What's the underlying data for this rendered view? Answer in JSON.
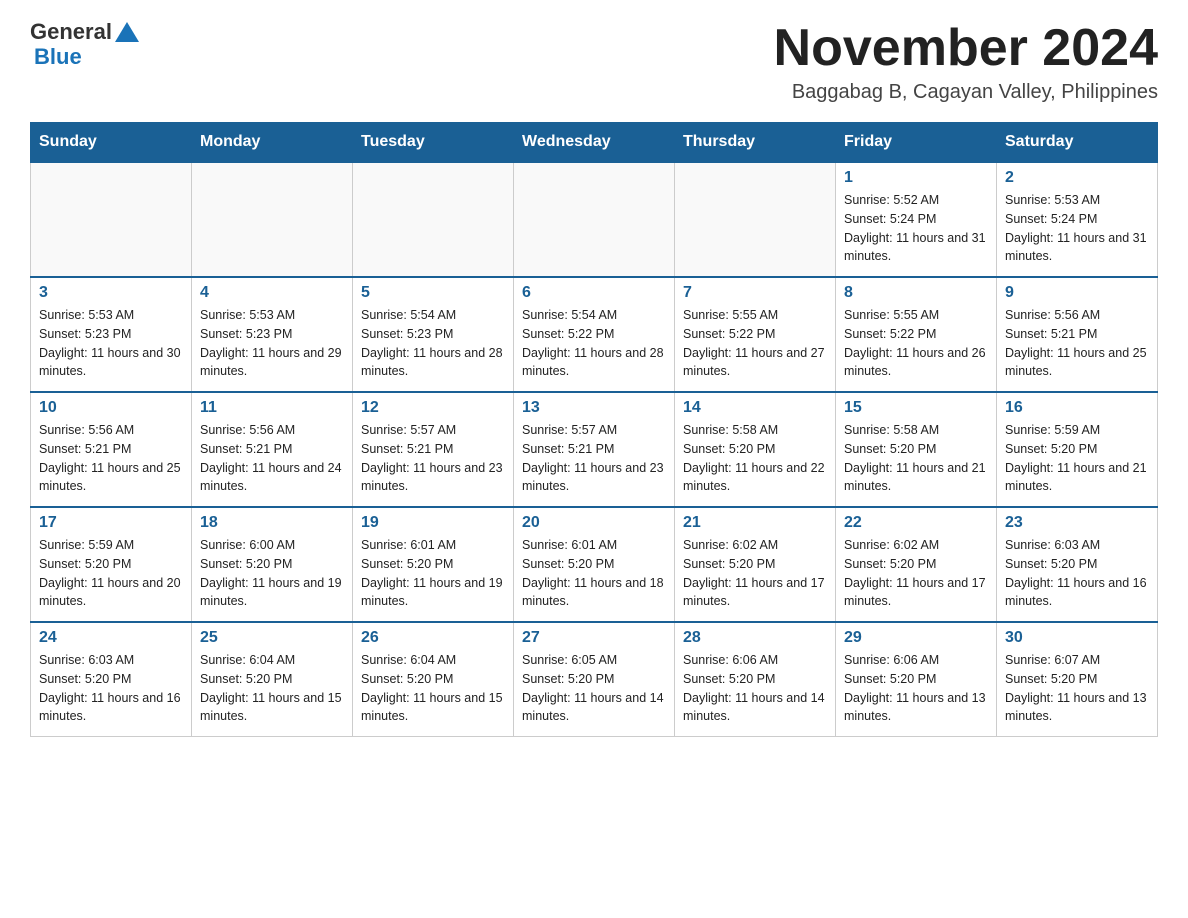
{
  "header": {
    "logo_general": "General",
    "logo_blue": "Blue",
    "month_title": "November 2024",
    "location": "Baggabag B, Cagayan Valley, Philippines"
  },
  "calendar": {
    "days_of_week": [
      "Sunday",
      "Monday",
      "Tuesday",
      "Wednesday",
      "Thursday",
      "Friday",
      "Saturday"
    ],
    "weeks": [
      [
        {
          "day": "",
          "info": ""
        },
        {
          "day": "",
          "info": ""
        },
        {
          "day": "",
          "info": ""
        },
        {
          "day": "",
          "info": ""
        },
        {
          "day": "",
          "info": ""
        },
        {
          "day": "1",
          "info": "Sunrise: 5:52 AM\nSunset: 5:24 PM\nDaylight: 11 hours and 31 minutes."
        },
        {
          "day": "2",
          "info": "Sunrise: 5:53 AM\nSunset: 5:24 PM\nDaylight: 11 hours and 31 minutes."
        }
      ],
      [
        {
          "day": "3",
          "info": "Sunrise: 5:53 AM\nSunset: 5:23 PM\nDaylight: 11 hours and 30 minutes."
        },
        {
          "day": "4",
          "info": "Sunrise: 5:53 AM\nSunset: 5:23 PM\nDaylight: 11 hours and 29 minutes."
        },
        {
          "day": "5",
          "info": "Sunrise: 5:54 AM\nSunset: 5:23 PM\nDaylight: 11 hours and 28 minutes."
        },
        {
          "day": "6",
          "info": "Sunrise: 5:54 AM\nSunset: 5:22 PM\nDaylight: 11 hours and 28 minutes."
        },
        {
          "day": "7",
          "info": "Sunrise: 5:55 AM\nSunset: 5:22 PM\nDaylight: 11 hours and 27 minutes."
        },
        {
          "day": "8",
          "info": "Sunrise: 5:55 AM\nSunset: 5:22 PM\nDaylight: 11 hours and 26 minutes."
        },
        {
          "day": "9",
          "info": "Sunrise: 5:56 AM\nSunset: 5:21 PM\nDaylight: 11 hours and 25 minutes."
        }
      ],
      [
        {
          "day": "10",
          "info": "Sunrise: 5:56 AM\nSunset: 5:21 PM\nDaylight: 11 hours and 25 minutes."
        },
        {
          "day": "11",
          "info": "Sunrise: 5:56 AM\nSunset: 5:21 PM\nDaylight: 11 hours and 24 minutes."
        },
        {
          "day": "12",
          "info": "Sunrise: 5:57 AM\nSunset: 5:21 PM\nDaylight: 11 hours and 23 minutes."
        },
        {
          "day": "13",
          "info": "Sunrise: 5:57 AM\nSunset: 5:21 PM\nDaylight: 11 hours and 23 minutes."
        },
        {
          "day": "14",
          "info": "Sunrise: 5:58 AM\nSunset: 5:20 PM\nDaylight: 11 hours and 22 minutes."
        },
        {
          "day": "15",
          "info": "Sunrise: 5:58 AM\nSunset: 5:20 PM\nDaylight: 11 hours and 21 minutes."
        },
        {
          "day": "16",
          "info": "Sunrise: 5:59 AM\nSunset: 5:20 PM\nDaylight: 11 hours and 21 minutes."
        }
      ],
      [
        {
          "day": "17",
          "info": "Sunrise: 5:59 AM\nSunset: 5:20 PM\nDaylight: 11 hours and 20 minutes."
        },
        {
          "day": "18",
          "info": "Sunrise: 6:00 AM\nSunset: 5:20 PM\nDaylight: 11 hours and 19 minutes."
        },
        {
          "day": "19",
          "info": "Sunrise: 6:01 AM\nSunset: 5:20 PM\nDaylight: 11 hours and 19 minutes."
        },
        {
          "day": "20",
          "info": "Sunrise: 6:01 AM\nSunset: 5:20 PM\nDaylight: 11 hours and 18 minutes."
        },
        {
          "day": "21",
          "info": "Sunrise: 6:02 AM\nSunset: 5:20 PM\nDaylight: 11 hours and 17 minutes."
        },
        {
          "day": "22",
          "info": "Sunrise: 6:02 AM\nSunset: 5:20 PM\nDaylight: 11 hours and 17 minutes."
        },
        {
          "day": "23",
          "info": "Sunrise: 6:03 AM\nSunset: 5:20 PM\nDaylight: 11 hours and 16 minutes."
        }
      ],
      [
        {
          "day": "24",
          "info": "Sunrise: 6:03 AM\nSunset: 5:20 PM\nDaylight: 11 hours and 16 minutes."
        },
        {
          "day": "25",
          "info": "Sunrise: 6:04 AM\nSunset: 5:20 PM\nDaylight: 11 hours and 15 minutes."
        },
        {
          "day": "26",
          "info": "Sunrise: 6:04 AM\nSunset: 5:20 PM\nDaylight: 11 hours and 15 minutes."
        },
        {
          "day": "27",
          "info": "Sunrise: 6:05 AM\nSunset: 5:20 PM\nDaylight: 11 hours and 14 minutes."
        },
        {
          "day": "28",
          "info": "Sunrise: 6:06 AM\nSunset: 5:20 PM\nDaylight: 11 hours and 14 minutes."
        },
        {
          "day": "29",
          "info": "Sunrise: 6:06 AM\nSunset: 5:20 PM\nDaylight: 11 hours and 13 minutes."
        },
        {
          "day": "30",
          "info": "Sunrise: 6:07 AM\nSunset: 5:20 PM\nDaylight: 11 hours and 13 minutes."
        }
      ]
    ]
  }
}
